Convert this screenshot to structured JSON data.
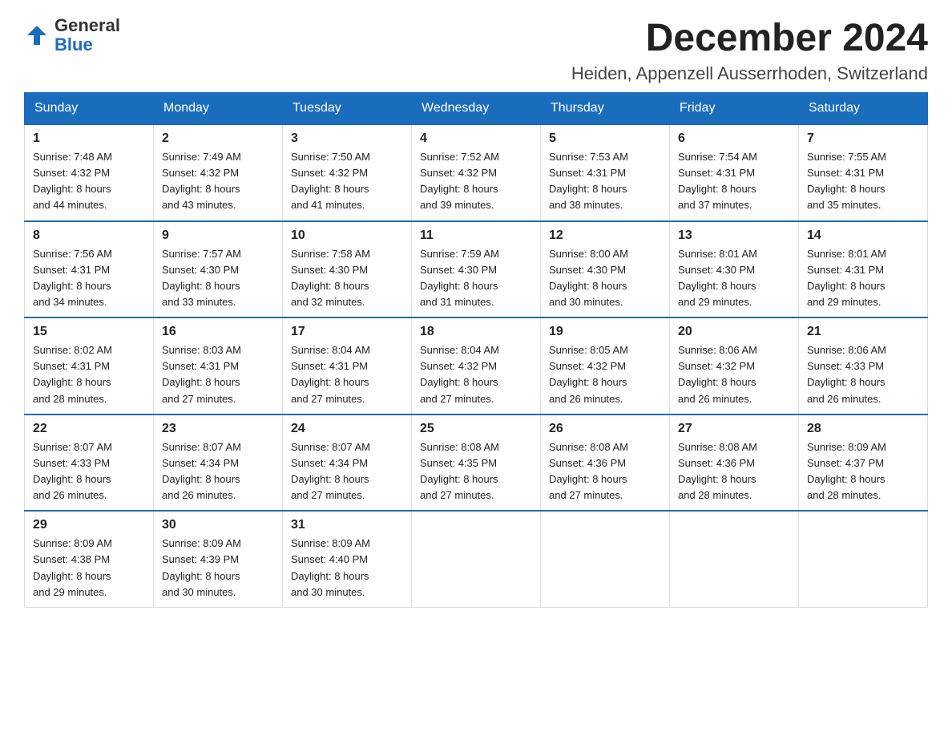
{
  "logo": {
    "general": "General",
    "blue": "Blue"
  },
  "header": {
    "month": "December 2024",
    "location": "Heiden, Appenzell Ausserrhoden, Switzerland"
  },
  "days_of_week": [
    "Sunday",
    "Monday",
    "Tuesday",
    "Wednesday",
    "Thursday",
    "Friday",
    "Saturday"
  ],
  "weeks": [
    [
      {
        "day": "1",
        "sunrise": "7:48 AM",
        "sunset": "4:32 PM",
        "daylight": "8 hours and 44 minutes."
      },
      {
        "day": "2",
        "sunrise": "7:49 AM",
        "sunset": "4:32 PM",
        "daylight": "8 hours and 43 minutes."
      },
      {
        "day": "3",
        "sunrise": "7:50 AM",
        "sunset": "4:32 PM",
        "daylight": "8 hours and 41 minutes."
      },
      {
        "day": "4",
        "sunrise": "7:52 AM",
        "sunset": "4:32 PM",
        "daylight": "8 hours and 39 minutes."
      },
      {
        "day": "5",
        "sunrise": "7:53 AM",
        "sunset": "4:31 PM",
        "daylight": "8 hours and 38 minutes."
      },
      {
        "day": "6",
        "sunrise": "7:54 AM",
        "sunset": "4:31 PM",
        "daylight": "8 hours and 37 minutes."
      },
      {
        "day": "7",
        "sunrise": "7:55 AM",
        "sunset": "4:31 PM",
        "daylight": "8 hours and 35 minutes."
      }
    ],
    [
      {
        "day": "8",
        "sunrise": "7:56 AM",
        "sunset": "4:31 PM",
        "daylight": "8 hours and 34 minutes."
      },
      {
        "day": "9",
        "sunrise": "7:57 AM",
        "sunset": "4:30 PM",
        "daylight": "8 hours and 33 minutes."
      },
      {
        "day": "10",
        "sunrise": "7:58 AM",
        "sunset": "4:30 PM",
        "daylight": "8 hours and 32 minutes."
      },
      {
        "day": "11",
        "sunrise": "7:59 AM",
        "sunset": "4:30 PM",
        "daylight": "8 hours and 31 minutes."
      },
      {
        "day": "12",
        "sunrise": "8:00 AM",
        "sunset": "4:30 PM",
        "daylight": "8 hours and 30 minutes."
      },
      {
        "day": "13",
        "sunrise": "8:01 AM",
        "sunset": "4:30 PM",
        "daylight": "8 hours and 29 minutes."
      },
      {
        "day": "14",
        "sunrise": "8:01 AM",
        "sunset": "4:31 PM",
        "daylight": "8 hours and 29 minutes."
      }
    ],
    [
      {
        "day": "15",
        "sunrise": "8:02 AM",
        "sunset": "4:31 PM",
        "daylight": "8 hours and 28 minutes."
      },
      {
        "day": "16",
        "sunrise": "8:03 AM",
        "sunset": "4:31 PM",
        "daylight": "8 hours and 27 minutes."
      },
      {
        "day": "17",
        "sunrise": "8:04 AM",
        "sunset": "4:31 PM",
        "daylight": "8 hours and 27 minutes."
      },
      {
        "day": "18",
        "sunrise": "8:04 AM",
        "sunset": "4:32 PM",
        "daylight": "8 hours and 27 minutes."
      },
      {
        "day": "19",
        "sunrise": "8:05 AM",
        "sunset": "4:32 PM",
        "daylight": "8 hours and 26 minutes."
      },
      {
        "day": "20",
        "sunrise": "8:06 AM",
        "sunset": "4:32 PM",
        "daylight": "8 hours and 26 minutes."
      },
      {
        "day": "21",
        "sunrise": "8:06 AM",
        "sunset": "4:33 PM",
        "daylight": "8 hours and 26 minutes."
      }
    ],
    [
      {
        "day": "22",
        "sunrise": "8:07 AM",
        "sunset": "4:33 PM",
        "daylight": "8 hours and 26 minutes."
      },
      {
        "day": "23",
        "sunrise": "8:07 AM",
        "sunset": "4:34 PM",
        "daylight": "8 hours and 26 minutes."
      },
      {
        "day": "24",
        "sunrise": "8:07 AM",
        "sunset": "4:34 PM",
        "daylight": "8 hours and 27 minutes."
      },
      {
        "day": "25",
        "sunrise": "8:08 AM",
        "sunset": "4:35 PM",
        "daylight": "8 hours and 27 minutes."
      },
      {
        "day": "26",
        "sunrise": "8:08 AM",
        "sunset": "4:36 PM",
        "daylight": "8 hours and 27 minutes."
      },
      {
        "day": "27",
        "sunrise": "8:08 AM",
        "sunset": "4:36 PM",
        "daylight": "8 hours and 28 minutes."
      },
      {
        "day": "28",
        "sunrise": "8:09 AM",
        "sunset": "4:37 PM",
        "daylight": "8 hours and 28 minutes."
      }
    ],
    [
      {
        "day": "29",
        "sunrise": "8:09 AM",
        "sunset": "4:38 PM",
        "daylight": "8 hours and 29 minutes."
      },
      {
        "day": "30",
        "sunrise": "8:09 AM",
        "sunset": "4:39 PM",
        "daylight": "8 hours and 30 minutes."
      },
      {
        "day": "31",
        "sunrise": "8:09 AM",
        "sunset": "4:40 PM",
        "daylight": "8 hours and 30 minutes."
      },
      null,
      null,
      null,
      null
    ]
  ],
  "labels": {
    "sunrise": "Sunrise:",
    "sunset": "Sunset:",
    "daylight": "Daylight:"
  }
}
